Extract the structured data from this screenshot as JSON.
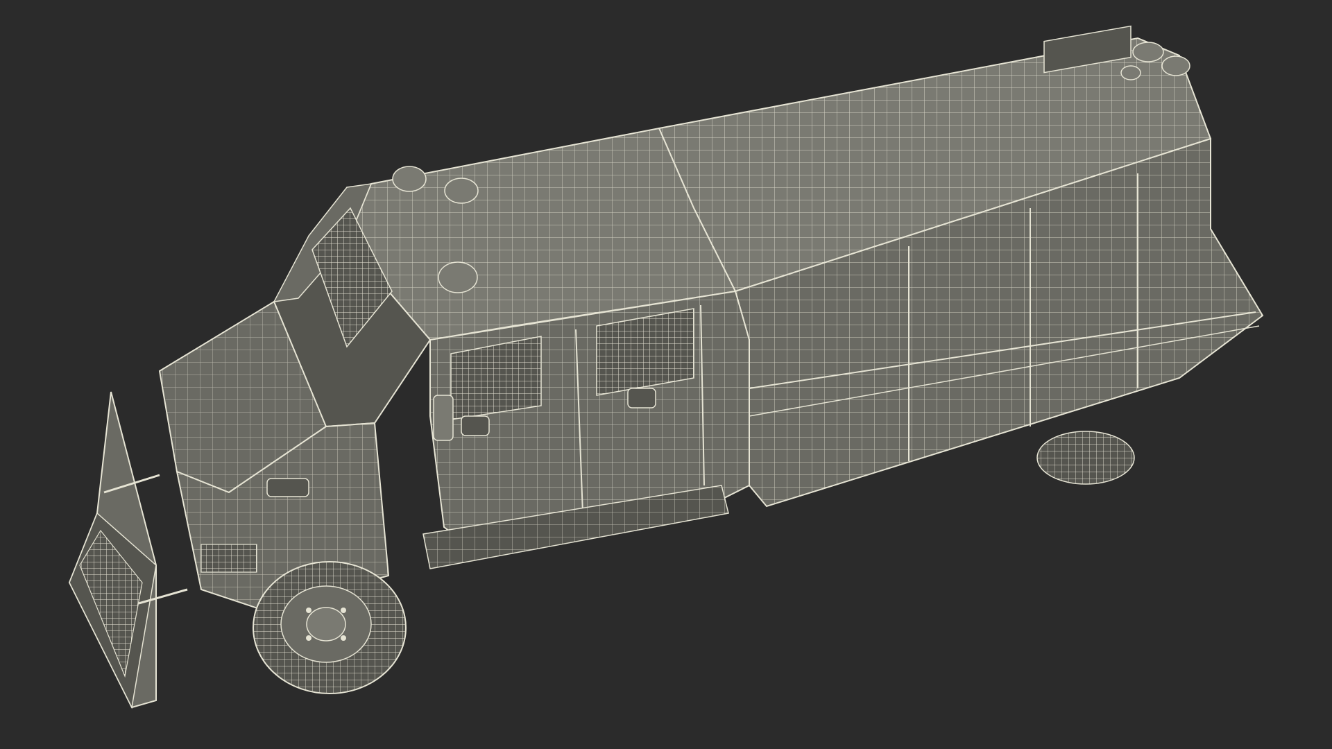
{
  "scene": {
    "subject": "armored-vehicle-wireframe",
    "colors": {
      "background": "#2b2b2b",
      "body_fill": "#6a6a63",
      "body_fill_dark": "#55554f",
      "body_fill_light": "#7a7a72",
      "wire": "#e6e4d4",
      "wire_dim": "#cfccbc",
      "shadow": "#1e1e1e"
    }
  }
}
